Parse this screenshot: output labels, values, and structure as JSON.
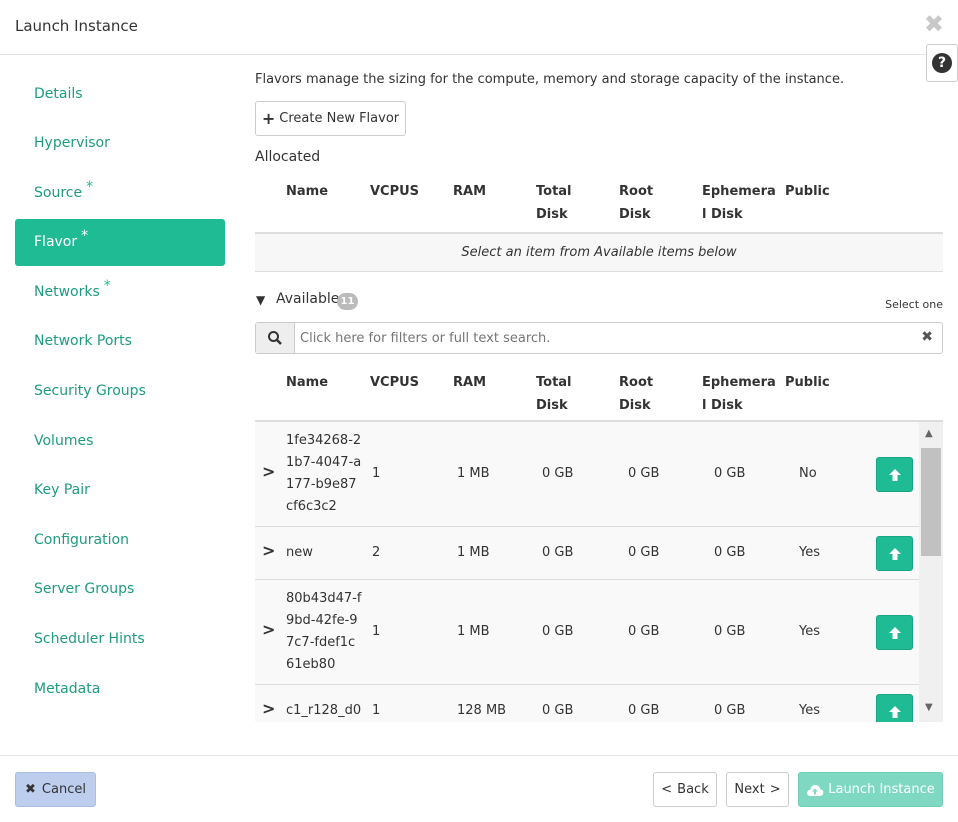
{
  "header": {
    "title": "Launch Instance",
    "close_icon": "close-icon",
    "help_icon": "question-circle-icon"
  },
  "sidebar": {
    "items": [
      {
        "label": "Details",
        "required": ""
      },
      {
        "label": "Hypervisor",
        "required": ""
      },
      {
        "label": "Source",
        "required": "*"
      },
      {
        "label": "Flavor",
        "required": "*",
        "active": true
      },
      {
        "label": "Networks",
        "required": "*"
      },
      {
        "label": "Network Ports",
        "required": ""
      },
      {
        "label": "Security Groups",
        "required": ""
      },
      {
        "label": "Volumes",
        "required": ""
      },
      {
        "label": "Key Pair",
        "required": ""
      },
      {
        "label": "Configuration",
        "required": ""
      },
      {
        "label": "Server Groups",
        "required": ""
      },
      {
        "label": "Scheduler Hints",
        "required": ""
      },
      {
        "label": "Metadata",
        "required": ""
      }
    ]
  },
  "main": {
    "description": "Flavors manage the sizing for the compute, memory and storage capacity of the instance.",
    "create_flavor_label": "Create New Flavor",
    "allocated_label": "Allocated",
    "allocated_empty": "Select an item from Available items below",
    "available_label": "Available",
    "available_count": "11",
    "select_one": "Select one",
    "search_placeholder": "Click here for filters or full text search.",
    "columns": {
      "name": "Name",
      "vcpus": "VCPUS",
      "ram": "RAM",
      "total_disk_1": "Total",
      "total_disk_2": "Disk",
      "root_disk_1": "Root",
      "root_disk_2": "Disk",
      "ephemeral_1": "Ephemera",
      "ephemeral_2": "l Disk",
      "public": "Public"
    },
    "rows": [
      {
        "name": "1fe34268-21b7-4047-a177-b9e87cf6c3c2",
        "vcpus": "1",
        "ram": "1 MB",
        "total_disk": "0 GB",
        "root_disk": "0 GB",
        "ephemeral": "0 GB",
        "public": "No"
      },
      {
        "name": "new",
        "vcpus": "2",
        "ram": "1 MB",
        "total_disk": "0 GB",
        "root_disk": "0 GB",
        "ephemeral": "0 GB",
        "public": "Yes"
      },
      {
        "name": "80b43d47-f9bd-42fe-97c7-fdef1c61eb80",
        "vcpus": "1",
        "ram": "1 MB",
        "total_disk": "0 GB",
        "root_disk": "0 GB",
        "ephemeral": "0 GB",
        "public": "Yes"
      },
      {
        "name": "c1_r128_d0",
        "vcpus": "1",
        "ram": "128 MB",
        "total_disk": "0 GB",
        "root_disk": "0 GB",
        "ephemeral": "0 GB",
        "public": "Yes"
      }
    ]
  },
  "footer": {
    "cancel": "Cancel",
    "back": "Back",
    "next": "Next",
    "launch": "Launch Instance"
  },
  "colors": {
    "accent": "#1fbb94",
    "link": "#1e9b80",
    "cancel_bg": "#bdcdee",
    "launch_disabled": "#7fd9c2"
  }
}
